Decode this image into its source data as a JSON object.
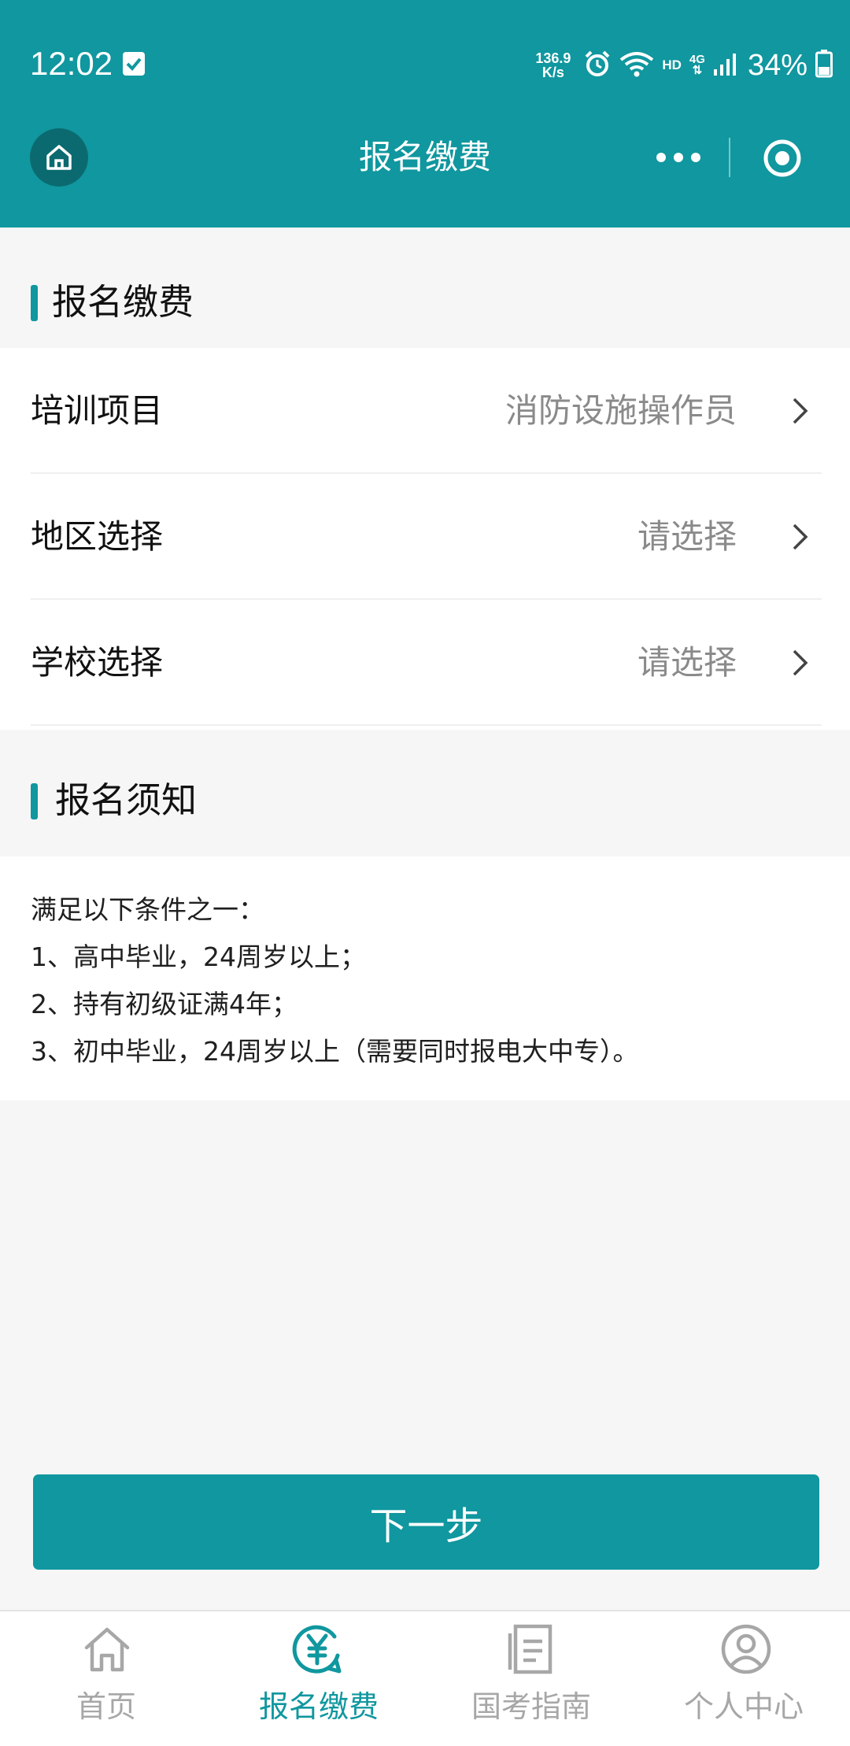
{
  "status_bar": {
    "time": "12:02",
    "speed_value": "136.9",
    "speed_unit": "K/s",
    "hd": "HD",
    "network": "4G",
    "battery": "34%"
  },
  "nav": {
    "title": "报名缴费"
  },
  "registration": {
    "section_title": "报名缴费",
    "rows": [
      {
        "label": "培训项目",
        "value": "消防设施操作员"
      },
      {
        "label": "地区选择",
        "value": "请选择"
      },
      {
        "label": "学校选择",
        "value": "请选择"
      }
    ]
  },
  "notice": {
    "section_title": "报名须知",
    "lines": [
      "满足以下条件之一：",
      "1、高中毕业，24周岁以上；",
      "2、持有初级证满4年；",
      "3、初中毕业，24周岁以上（需要同时报电大中专）。"
    ]
  },
  "actions": {
    "next_label": "下一步"
  },
  "tabbar": {
    "items": [
      {
        "label": "首页",
        "icon": "house-icon",
        "active": false
      },
      {
        "label": "报名缴费",
        "icon": "yuan-payment-icon",
        "active": true
      },
      {
        "label": "国考指南",
        "icon": "document-icon",
        "active": false
      },
      {
        "label": "个人中心",
        "icon": "user-circle-icon",
        "active": false
      }
    ]
  },
  "colors": {
    "brand": "#10979f",
    "inactive": "#a7a7a7"
  }
}
